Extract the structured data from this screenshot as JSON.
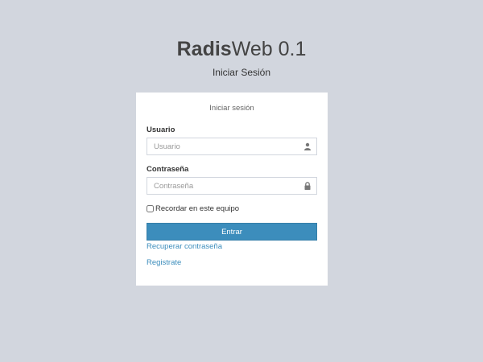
{
  "header": {
    "brand_bold": "Radis",
    "brand_light": "Web 0.1",
    "subtitle": "Iniciar Sesión"
  },
  "login": {
    "box_message": "Iniciar sesión",
    "username": {
      "label": "Usuario",
      "placeholder": "Usuario",
      "value": "",
      "icon": "user-icon"
    },
    "password": {
      "label": "Contraseña",
      "placeholder": "Contraseña",
      "value": "",
      "icon": "lock-icon"
    },
    "remember_label": "Recordar en este equipo",
    "remember_checked": false,
    "submit_label": "Entrar",
    "recover_link": "Recuperar contraseña",
    "register_link": "Registrate"
  },
  "colors": {
    "background": "#d2d6de",
    "primary": "#3c8dbc",
    "link": "#3c8dbc"
  }
}
